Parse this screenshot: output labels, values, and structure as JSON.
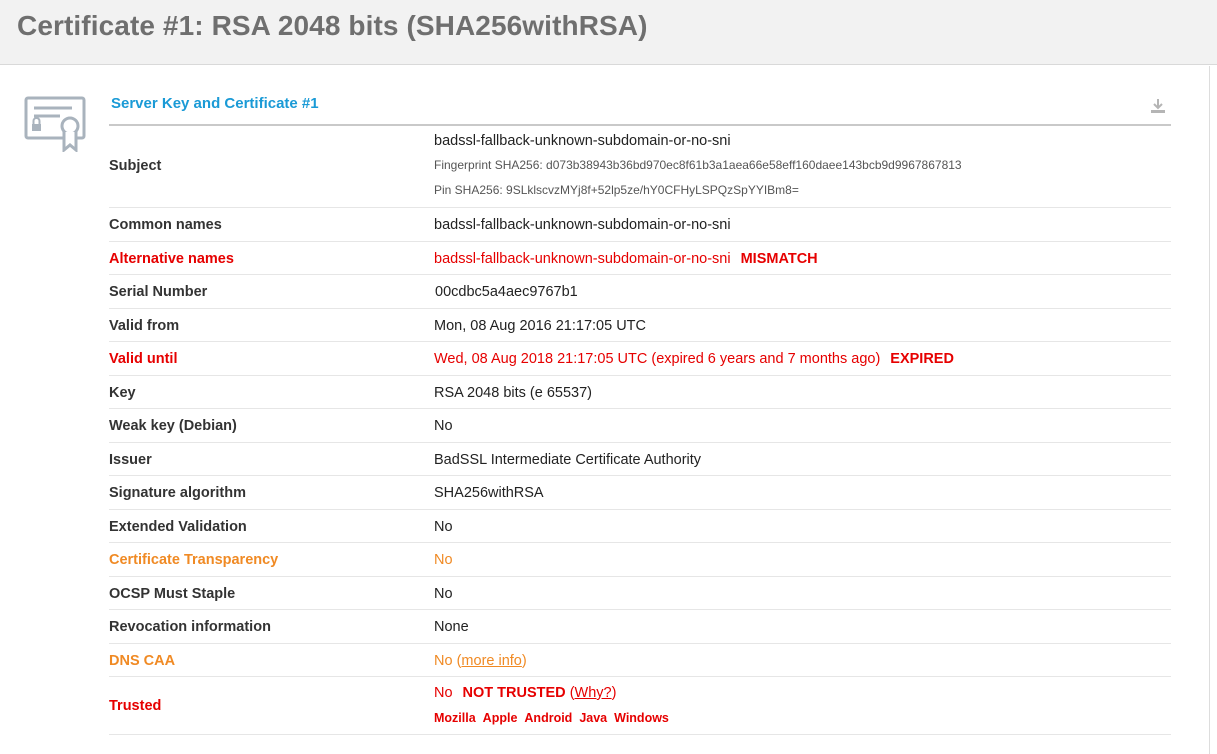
{
  "page": {
    "title": "Certificate #1: RSA 2048 bits (SHA256withRSA)"
  },
  "section": {
    "title": "Server Key and Certificate #1",
    "icon": "certificate-icon",
    "download_icon": "download-icon"
  },
  "colors": {
    "accent": "#1a9ad6",
    "error": "#e60000",
    "warning": "#f08a24",
    "title_gray": "#6f6f6f"
  },
  "rows": {
    "subject": {
      "label": "Subject",
      "value": "badssl-fallback-unknown-subdomain-or-no-sni",
      "fingerprint": "Fingerprint SHA256: d073b38943b36bd970ec8f61b3a1aea66e58eff160daee143bcb9d9967867813",
      "pin": "Pin SHA256: 9SLklscvzMYj8f+52lp5ze/hY0CFHyLSPQzSpYYIBm8="
    },
    "common_names": {
      "label": "Common names",
      "value": "badssl-fallback-unknown-subdomain-or-no-sni"
    },
    "alt_names": {
      "label": "Alternative names",
      "value": "badssl-fallback-unknown-subdomain-or-no-sni",
      "badge": "MISMATCH"
    },
    "serial": {
      "label": "Serial Number",
      "value": "00cdbc5a4aec9767b1"
    },
    "valid_from": {
      "label": "Valid from",
      "value": "Mon, 08 Aug 2016 21:17:05 UTC"
    },
    "valid_until": {
      "label": "Valid until",
      "value": "Wed, 08 Aug 2018 21:17:05 UTC (expired 6 years and 7 months ago)",
      "badge": "EXPIRED"
    },
    "key": {
      "label": "Key",
      "value": "RSA 2048 bits (e 65537)"
    },
    "weak_key": {
      "label": "Weak key (Debian)",
      "value": "No"
    },
    "issuer": {
      "label": "Issuer",
      "value": "BadSSL Intermediate Certificate Authority"
    },
    "sig_alg": {
      "label": "Signature algorithm",
      "value": "SHA256withRSA"
    },
    "ev": {
      "label": "Extended Validation",
      "value": "No"
    },
    "ct": {
      "label": "Certificate Transparency",
      "value": "No"
    },
    "ocsp": {
      "label": "OCSP Must Staple",
      "value": "No"
    },
    "revocation": {
      "label": "Revocation information",
      "value": "None"
    },
    "dns_caa": {
      "label": "DNS CAA",
      "value": "No",
      "paren_open": "(",
      "link": "more info",
      "paren_close": ")"
    },
    "trusted": {
      "label": "Trusted",
      "value": "No",
      "badge": "NOT TRUSTED",
      "paren_open": "(",
      "link": "Why?",
      "paren_close": ")",
      "platforms": [
        "Mozilla",
        "Apple",
        "Android",
        "Java",
        "Windows"
      ]
    }
  }
}
